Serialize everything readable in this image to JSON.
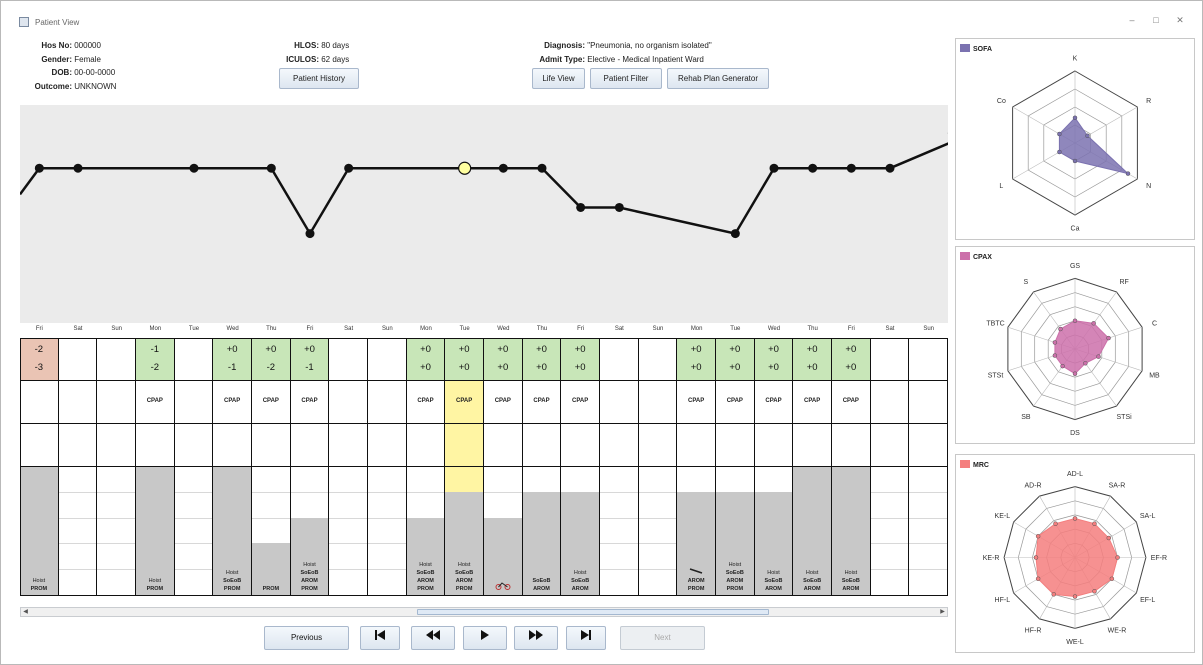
{
  "window": {
    "title": "Patient View",
    "controls": [
      "–",
      "□",
      "✕"
    ]
  },
  "patient": {
    "hos_no_label": "Hos No:",
    "hos_no": "000000",
    "gender_label": "Gender:",
    "gender": "Female",
    "dob_label": "DOB:",
    "dob": "00-00-0000",
    "outcome_label": "Outcome:",
    "outcome": "UNKNOWN",
    "hlos_label": "HLOS:",
    "hlos": "80 days",
    "iculos_label": "ICULOS:",
    "iculos": "62 days",
    "diagnosis_label": "Diagnosis:",
    "diagnosis": "\"Pneumonia, no organism isolated\"",
    "admit_type_label": "Admit Type:",
    "admit_type": "Elective  -  Medical Inpatient Ward"
  },
  "buttons": {
    "patient_history": "Patient History",
    "life_view": "Life View",
    "patient_filter": "Patient Filter",
    "rehab_plan": "Rehab Plan Generator",
    "previous": "Previous",
    "next": "Next"
  },
  "colors": {
    "chart_bg": "#ebebeb",
    "green": "#c8e6b8",
    "red": "#eac4b4",
    "yellow": "#fff5a3",
    "bar": "#c8c8c8",
    "selected_point": "#ffffa0",
    "sofa": "#7b72b0",
    "cpax": "#cc70aa",
    "mrc": "#f47e7e"
  },
  "timeline": {
    "line_values": [
      2,
      2,
      null,
      null,
      2,
      null,
      2,
      1,
      2,
      null,
      null,
      2,
      2,
      2,
      1.4,
      1.4,
      null,
      null,
      1,
      2,
      2,
      2,
      2,
      null,
      2.5
    ],
    "selected_index": 11,
    "days": [
      {
        "day": "Fri",
        "s1": "-2",
        "s2": "-3",
        "tone": "red",
        "resp": "",
        "bar": 100,
        "act": [
          "Hoist",
          ""
        ],
        "act2": "PROM"
      },
      {
        "day": "Sat",
        "s1": "",
        "s2": "",
        "tone": "",
        "resp": "",
        "bar": 0,
        "act": [],
        "act2": ""
      },
      {
        "day": "Sun",
        "s1": "",
        "s2": "",
        "tone": "",
        "resp": "",
        "bar": 0,
        "act": [],
        "act2": ""
      },
      {
        "day": "Mon",
        "s1": "-1",
        "s2": "-2",
        "tone": "green",
        "resp": "CPAP",
        "bar": 100,
        "act": [
          "Hoist"
        ],
        "act2": "PROM"
      },
      {
        "day": "Tue",
        "s1": "",
        "s2": "",
        "tone": "",
        "resp": "",
        "bar": 0,
        "act": [],
        "act2": ""
      },
      {
        "day": "Wed",
        "s1": "+0",
        "s2": "-1",
        "tone": "green",
        "resp": "CPAP",
        "bar": 100,
        "act": [
          "Hoist",
          "SoEoB"
        ],
        "act2": "PROM"
      },
      {
        "day": "Thu",
        "s1": "+0",
        "s2": "-2",
        "tone": "green",
        "resp": "CPAP",
        "bar": 40,
        "act": [],
        "act2": "PROM"
      },
      {
        "day": "Fri",
        "s1": "+0",
        "s2": "-1",
        "tone": "green",
        "resp": "CPAP",
        "bar": 60,
        "act": [
          "Hoist",
          "SoEoB",
          "AROM"
        ],
        "act2": "PROM"
      },
      {
        "day": "Sat",
        "s1": "",
        "s2": "",
        "tone": "",
        "resp": "",
        "bar": 0,
        "act": [],
        "act2": ""
      },
      {
        "day": "Sun",
        "s1": "",
        "s2": "",
        "tone": "",
        "resp": "",
        "bar": 0,
        "act": [],
        "act2": ""
      },
      {
        "day": "Mon",
        "s1": "+0",
        "s2": "+0",
        "tone": "green",
        "resp": "CPAP",
        "bar": 60,
        "act": [
          "Hoist",
          "SoEoB",
          "AROM"
        ],
        "act2": "PROM"
      },
      {
        "day": "Tue",
        "s1": "+0",
        "s2": "+0",
        "tone": "green",
        "resp": "CPAP",
        "bar": 80,
        "sel": true,
        "act": [
          "Hoist",
          "SoEoB",
          "AROM"
        ],
        "act2": "PROM"
      },
      {
        "day": "Wed",
        "s1": "+0",
        "s2": "+0",
        "tone": "green",
        "resp": "CPAP",
        "bar": 60,
        "act": [],
        "act2": "bike"
      },
      {
        "day": "Thu",
        "s1": "+0",
        "s2": "+0",
        "tone": "green",
        "resp": "CPAP",
        "bar": 80,
        "act": [
          "SoEoB"
        ],
        "act2": "AROM"
      },
      {
        "day": "Fri",
        "s1": "+0",
        "s2": "+0",
        "tone": "green",
        "resp": "CPAP",
        "bar": 80,
        "act": [
          "Hoist",
          "SoEoB"
        ],
        "act2": "AROM"
      },
      {
        "day": "Sat",
        "s1": "",
        "s2": "",
        "tone": "",
        "resp": "",
        "bar": 0,
        "act": [],
        "act2": ""
      },
      {
        "day": "Sun",
        "s1": "",
        "s2": "",
        "tone": "",
        "resp": "",
        "bar": 0,
        "act": [],
        "act2": ""
      },
      {
        "day": "Mon",
        "s1": "+0",
        "s2": "+0",
        "tone": "green",
        "resp": "CPAP",
        "bar": 80,
        "act": [
          "walk",
          "AROM"
        ],
        "act2": "PROM"
      },
      {
        "day": "Tue",
        "s1": "+0",
        "s2": "+0",
        "tone": "green",
        "resp": "CPAP",
        "bar": 80,
        "act": [
          "Hoist",
          "SoEoB",
          "AROM"
        ],
        "act2": "PROM"
      },
      {
        "day": "Wed",
        "s1": "+0",
        "s2": "+0",
        "tone": "green",
        "resp": "CPAP",
        "bar": 80,
        "act": [
          "Hoist",
          "SoEoB"
        ],
        "act2": "AROM"
      },
      {
        "day": "Thu",
        "s1": "+0",
        "s2": "+0",
        "tone": "green",
        "resp": "CPAP",
        "bar": 100,
        "act": [
          "Hoist",
          "SoEoB"
        ],
        "act2": "AROM"
      },
      {
        "day": "Fri",
        "s1": "+0",
        "s2": "+0",
        "tone": "green",
        "resp": "CPAP",
        "bar": 100,
        "act": [
          "Hoist",
          "SoEoB"
        ],
        "act2": "AROM"
      },
      {
        "day": "Sat",
        "s1": "",
        "s2": "",
        "tone": "",
        "resp": "",
        "bar": 0,
        "act": [],
        "act2": ""
      },
      {
        "day": "Sun",
        "s1": "",
        "s2": "",
        "tone": "",
        "resp": "",
        "bar": 0,
        "act": [],
        "act2": ""
      }
    ]
  },
  "radars": [
    {
      "key": "sofa",
      "title": "SOFA",
      "color": "#7b72b0",
      "labels": [
        "K",
        "R",
        "N",
        "Ca",
        "L",
        "Co"
      ],
      "values": [
        0.35,
        0.2,
        0.85,
        0.25,
        0.25,
        0.25
      ],
      "rings": 4
    },
    {
      "key": "cpax",
      "title": "CPAX",
      "color": "#cc70aa",
      "labels": [
        "GS",
        "RF",
        "C",
        "MB",
        "STSi",
        "DS",
        "SB",
        "STSt",
        "TBTC",
        "S"
      ],
      "values": [
        0.4,
        0.45,
        0.5,
        0.35,
        0.25,
        0.35,
        0.3,
        0.3,
        0.3,
        0.35
      ],
      "rings": 5
    },
    {
      "key": "mrc",
      "title": "MRC",
      "color": "#f47e7e",
      "labels": [
        "AD-L",
        "SA-R",
        "SA-L",
        "EF-R",
        "EF-L",
        "WE-R",
        "WE-L",
        "HF-R",
        "HF-L",
        "KE-R",
        "KE-L",
        "AD-R"
      ],
      "values": [
        0.55,
        0.55,
        0.55,
        0.6,
        0.6,
        0.55,
        0.55,
        0.6,
        0.6,
        0.55,
        0.6,
        0.55
      ],
      "rings": 5
    }
  ]
}
